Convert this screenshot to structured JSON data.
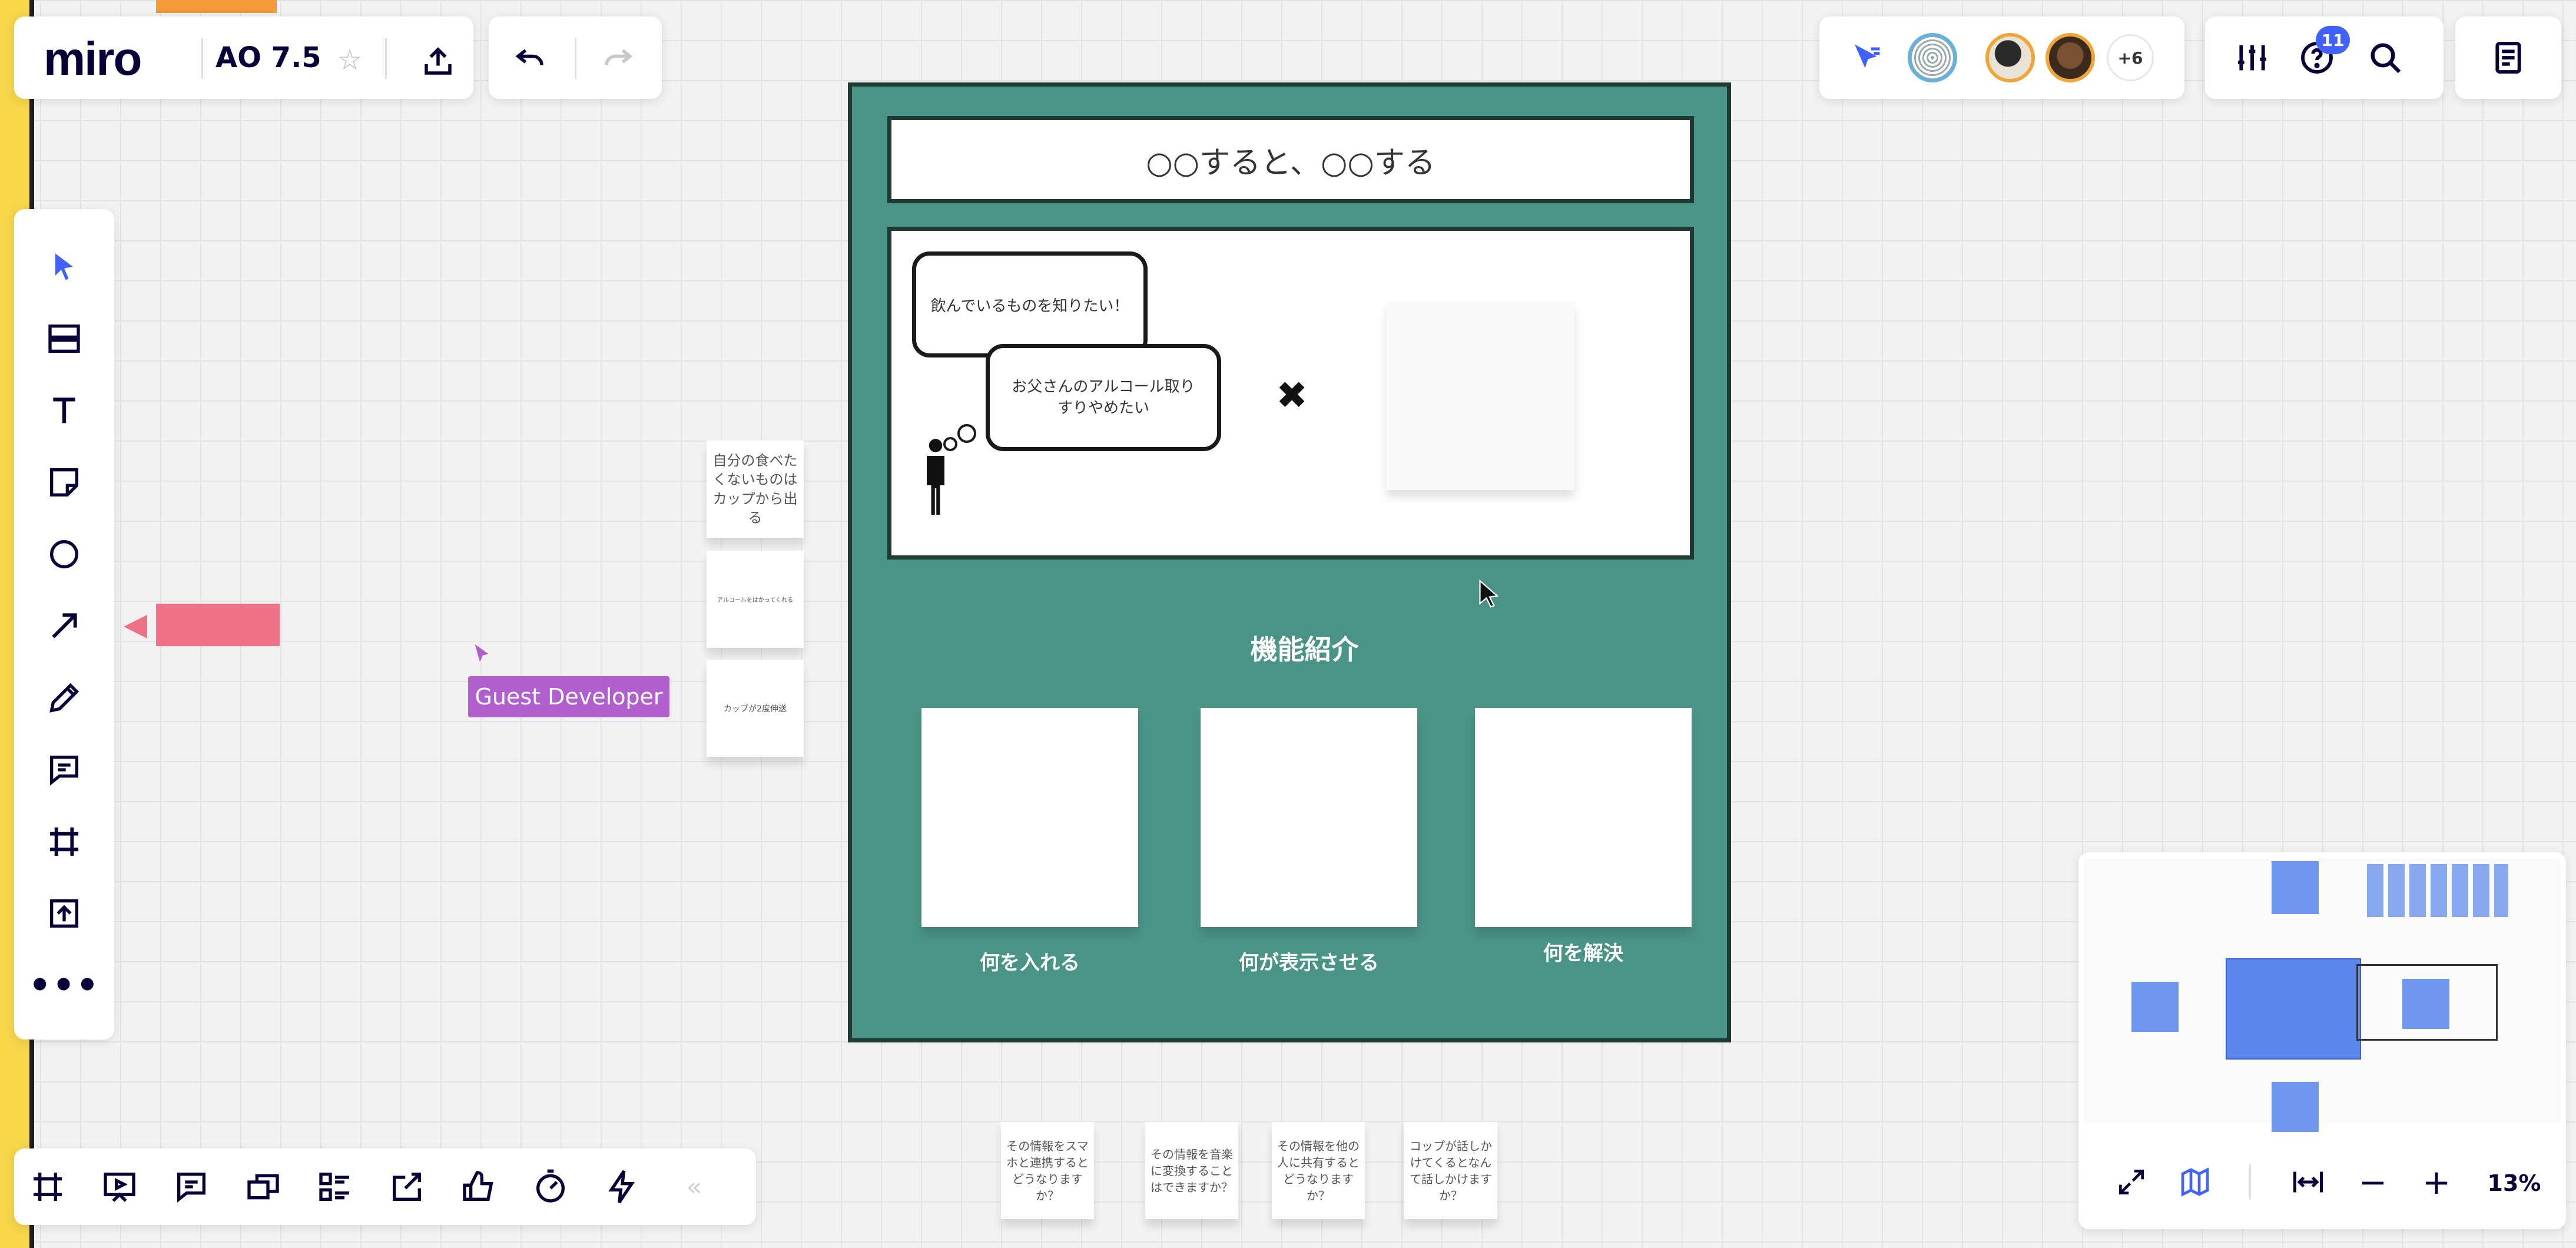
{
  "app": {
    "logo_text": "miro",
    "board_name": "AO 7.5",
    "colors": {
      "accent": "#4262ff",
      "frame_green": "#4a9486",
      "frame_border": "#1f3a33",
      "guest_label": "#b15fcf",
      "pink": "#ee7185"
    }
  },
  "toolbar_top_left": {
    "star_icon": "star-icon",
    "export_icon": "export-icon",
    "undo_icon": "undo-icon",
    "redo_icon": "redo-icon"
  },
  "toolbar_top_right": {
    "collaborators_more": "+6",
    "help_badge": "11"
  },
  "left_tools": [
    "select",
    "frames",
    "text",
    "sticky-note",
    "shape",
    "connection-line",
    "pen",
    "comment",
    "frame",
    "upload",
    "more"
  ],
  "canvas": {
    "title_box": "○○すると、○○する",
    "bubble1": "飲んでいるものを知りたい！",
    "bubble2": "お父さんのアルコール取りすりやめたい",
    "times_symbol": "✖",
    "section_title": "機能紹介",
    "feature_labels": [
      "何を入れる",
      "何が表示させる",
      "何を解決"
    ],
    "side_stickies": [
      "自分の食べたくないものはカップから出る",
      "アルコールをはかってくれる",
      "カップが2度伸送"
    ],
    "bottom_stickies": [
      "その情報をスマホと連携するとどうなりますか？",
      "その情報を音楽に変換することはできますか？",
      "その情報を他の人に共有するとどうなりますか？",
      "コップが話しかけてくるとなんて話しかけますか？"
    ],
    "guest_label": "Guest Developer"
  },
  "minimap": {
    "zoom": "13%"
  }
}
